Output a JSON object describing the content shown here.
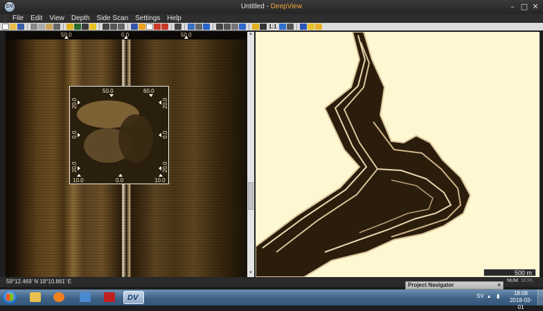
{
  "window": {
    "doc_name": "Untitled",
    "separator": " - ",
    "app_name": "DeepView",
    "app_icon_text": "DV",
    "minimize_icon": "minimize-icon",
    "maximize_icon": "maximize-icon",
    "close_icon": "close-icon"
  },
  "menu": {
    "items": [
      "File",
      "Edit",
      "View",
      "Depth",
      "Side Scan",
      "Settings",
      "Help"
    ]
  },
  "toolbar": {
    "icons": [
      "new-file-icon",
      "open-folder-icon",
      "save-icon",
      "cut-icon",
      "copy-icon",
      "paste-icon",
      "print-icon",
      "track-icon",
      "layers-icon",
      "grid-icon",
      "pin-icon",
      "pointer-icon",
      "zoom-icon",
      "rectangle-select-icon",
      "undo-icon",
      "redo-icon",
      "pen-icon",
      "target-icon",
      "line-icon",
      "globe-icon",
      "info-icon",
      "palette-icon",
      "filter-icon",
      "depth-icon",
      "range-icon"
    ],
    "ratio_label": "1:1"
  },
  "sonar": {
    "ruler_left": "50.0",
    "ruler_center": "0.0",
    "ruler_right": "50.0",
    "zoom": {
      "top_left": "50.0",
      "top_right": "60.0",
      "left_top": "20.0",
      "left_mid": "0.0",
      "left_bottom": "20.0",
      "right_top": "20.0",
      "right_mid": "0.0",
      "right_bottom": "20.0",
      "bottom_left": "10.0",
      "bottom_mid": "0.0",
      "bottom_right": "10.0"
    }
  },
  "map": {
    "scale_label": "500 m"
  },
  "status": {
    "coords": "59°12.469' N 18°10.861' E",
    "num": "NUM",
    "scrl": "SCRL"
  },
  "navigator": {
    "title": "Project Navigator",
    "close": "×"
  },
  "taskbar": {
    "apps": [
      "folder-icon",
      "media-player-icon",
      "network-tool-icon",
      "antivirus-icon",
      "deepview-icon"
    ],
    "active_app_label": "DV",
    "language": "SV",
    "time": "18:08",
    "date": "2018-03-01"
  },
  "colors": {
    "sonar_bright": "#f2e6c8",
    "sonar_mid": "#6a4d22",
    "sonar_dark": "#1a1206",
    "map_background": "#fdf8d2",
    "accent_title": "#f0a93c"
  }
}
